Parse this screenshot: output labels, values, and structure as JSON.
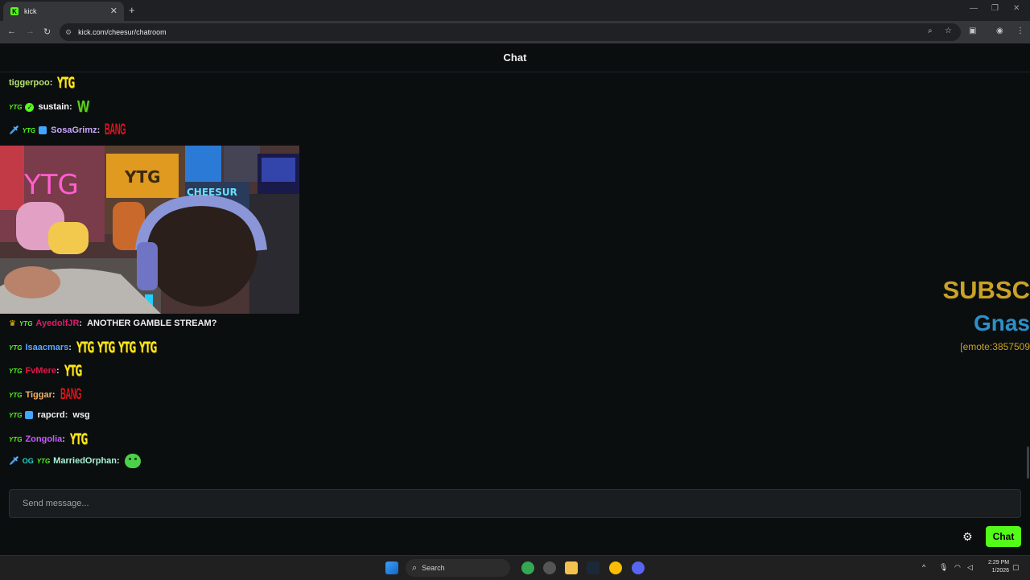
{
  "browser": {
    "tab_title": "kick",
    "favicon_letter": "K",
    "url": "kick.com/cheesur/chatroom"
  },
  "chat": {
    "header": "Chat",
    "messages_top": [
      {
        "badges": [],
        "user": "tiggerpoo",
        "user_color": "#b6e36c",
        "content": [
          {
            "type": "emote",
            "name": "YTG"
          }
        ]
      },
      {
        "badges": [
          "ytg",
          "verified"
        ],
        "user": "sustain",
        "user_color": "#ffffff",
        "content": [
          {
            "type": "emote",
            "name": "W"
          }
        ]
      },
      {
        "badges": [
          "sword",
          "ytg",
          "cube"
        ],
        "user": "SosaGrimz",
        "user_color": "#c9a6ff",
        "content": [
          {
            "type": "emote",
            "name": "BANG"
          }
        ]
      }
    ],
    "messages_bottom": [
      {
        "badges": [
          "crown",
          "ytg"
        ],
        "user": "AyedolfJR",
        "user_color": "#e4186b",
        "content": [
          {
            "type": "text",
            "value": "ANOTHER GAMBLE STREAM?"
          }
        ]
      },
      {
        "badges": [
          "ytg"
        ],
        "user": "Isaacmars",
        "user_color": "#5aa9ff",
        "content": [
          {
            "type": "emote",
            "name": "YTG"
          },
          {
            "type": "emote",
            "name": "YTG"
          },
          {
            "type": "emote",
            "name": "YTG"
          },
          {
            "type": "emote",
            "name": "YTG"
          }
        ]
      },
      {
        "badges": [
          "ytg"
        ],
        "user": "FvMere",
        "user_color": "#e5154a",
        "content": [
          {
            "type": "emote",
            "name": "YTG"
          }
        ]
      },
      {
        "badges": [
          "ytg"
        ],
        "user": "Tiggar",
        "user_color": "#f3b266",
        "content": [
          {
            "type": "emote",
            "name": "BANG"
          }
        ]
      },
      {
        "badges": [
          "ytg",
          "cube"
        ],
        "user": "rapcrd",
        "user_color": "#f0f0f0",
        "content": [
          {
            "type": "text",
            "value": "wsg"
          }
        ]
      },
      {
        "badges": [
          "ytg"
        ],
        "user": "Zongolia",
        "user_color": "#c65cff",
        "content": [
          {
            "type": "emote",
            "name": "YTG"
          }
        ]
      },
      {
        "badges": [
          "sword",
          "og",
          "ytg"
        ],
        "user": "MarriedOrphan",
        "user_color": "#a9f4d6",
        "content": [
          {
            "type": "emote",
            "name": "smile"
          }
        ]
      }
    ],
    "badge_ytg_label": "YTG",
    "badge_og_label": "OG",
    "emote_ytg_text": "YTG",
    "emote_w_text": "W",
    "emote_bang_text": "BANG",
    "stream_sign_label": "YTG",
    "stream_neon_label": "YTG",
    "stream_neon2_label": "CHEESUR",
    "input_placeholder": "Send message...",
    "send_button": "Chat"
  },
  "overlay": {
    "line1": "SUBSC",
    "line2": "Gnas",
    "line3": "[emote:3857509",
    "line1_color": "#c9a227",
    "line2_color": "#2e8fc7",
    "line3_color": "#c9a227"
  },
  "taskbar": {
    "search_label": "Search",
    "time": "2:29 PM",
    "date": "1/2026"
  },
  "colors": {
    "kick_green": "#53fc18",
    "background": "#0b0e0f"
  }
}
